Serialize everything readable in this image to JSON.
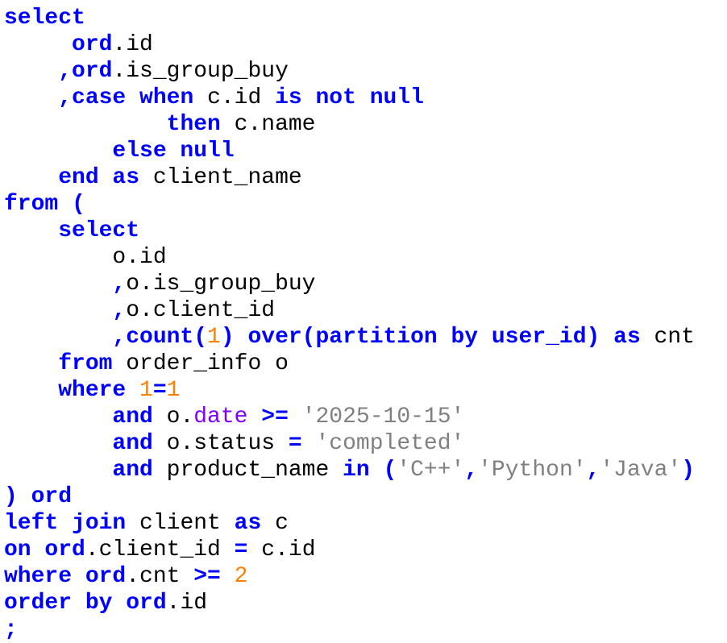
{
  "colors": {
    "keyword": "#0000ff",
    "number": "#ff8000",
    "string": "#808080",
    "function": "#8000ff",
    "text": "#000000",
    "background": "#ffffff"
  },
  "lines": [
    [
      {
        "t": "kw",
        "v": "select"
      }
    ],
    [
      {
        "t": "tx",
        "v": "     "
      },
      {
        "t": "kw",
        "v": "ord"
      },
      {
        "t": "tx",
        "v": ".id"
      }
    ],
    [
      {
        "t": "tx",
        "v": "    "
      },
      {
        "t": "kw",
        "v": ",ord"
      },
      {
        "t": "tx",
        "v": ".is_group_buy"
      }
    ],
    [
      {
        "t": "tx",
        "v": "    "
      },
      {
        "t": "kw",
        "v": ",case when "
      },
      {
        "t": "tx",
        "v": "c.id "
      },
      {
        "t": "kw",
        "v": "is not null"
      }
    ],
    [
      {
        "t": "tx",
        "v": "            "
      },
      {
        "t": "kw",
        "v": "then "
      },
      {
        "t": "tx",
        "v": "c.name"
      }
    ],
    [
      {
        "t": "tx",
        "v": "        "
      },
      {
        "t": "kw",
        "v": "else null"
      }
    ],
    [
      {
        "t": "tx",
        "v": "    "
      },
      {
        "t": "kw",
        "v": "end as "
      },
      {
        "t": "tx",
        "v": "client_name"
      }
    ],
    [
      {
        "t": "kw",
        "v": "from ("
      }
    ],
    [
      {
        "t": "tx",
        "v": "    "
      },
      {
        "t": "kw",
        "v": "select"
      }
    ],
    [
      {
        "t": "tx",
        "v": "        o.id"
      }
    ],
    [
      {
        "t": "tx",
        "v": "        "
      },
      {
        "t": "kw",
        "v": ","
      },
      {
        "t": "tx",
        "v": "o.is_group_buy"
      }
    ],
    [
      {
        "t": "tx",
        "v": "        "
      },
      {
        "t": "kw",
        "v": ","
      },
      {
        "t": "tx",
        "v": "o.client_id"
      }
    ],
    [
      {
        "t": "tx",
        "v": "        "
      },
      {
        "t": "kw",
        "v": ",count("
      },
      {
        "t": "num",
        "v": "1"
      },
      {
        "t": "kw",
        "v": ") over(partition by user_id) as "
      },
      {
        "t": "tx",
        "v": "cnt"
      }
    ],
    [
      {
        "t": "tx",
        "v": "    "
      },
      {
        "t": "kw",
        "v": "from "
      },
      {
        "t": "tx",
        "v": "order_info o"
      }
    ],
    [
      {
        "t": "tx",
        "v": "    "
      },
      {
        "t": "kw",
        "v": "where "
      },
      {
        "t": "num",
        "v": "1"
      },
      {
        "t": "kw",
        "v": "="
      },
      {
        "t": "num",
        "v": "1"
      }
    ],
    [
      {
        "t": "tx",
        "v": "        "
      },
      {
        "t": "kw",
        "v": "and "
      },
      {
        "t": "tx",
        "v": "o."
      },
      {
        "t": "fn",
        "v": "date"
      },
      {
        "t": "tx",
        "v": " "
      },
      {
        "t": "kw",
        "v": ">="
      },
      {
        "t": "tx",
        "v": " "
      },
      {
        "t": "str",
        "v": "'2025-10-15'"
      }
    ],
    [
      {
        "t": "tx",
        "v": "        "
      },
      {
        "t": "kw",
        "v": "and "
      },
      {
        "t": "tx",
        "v": "o.status "
      },
      {
        "t": "kw",
        "v": "="
      },
      {
        "t": "tx",
        "v": " "
      },
      {
        "t": "str",
        "v": "'completed'"
      }
    ],
    [
      {
        "t": "tx",
        "v": "        "
      },
      {
        "t": "kw",
        "v": "and "
      },
      {
        "t": "tx",
        "v": "product_name "
      },
      {
        "t": "kw",
        "v": "in ("
      },
      {
        "t": "str",
        "v": "'C++'"
      },
      {
        "t": "kw",
        "v": ","
      },
      {
        "t": "str",
        "v": "'Python'"
      },
      {
        "t": "kw",
        "v": ","
      },
      {
        "t": "str",
        "v": "'Java'"
      },
      {
        "t": "kw",
        "v": ")"
      }
    ],
    [
      {
        "t": "kw",
        "v": ") ord"
      }
    ],
    [
      {
        "t": "kw",
        "v": "left join "
      },
      {
        "t": "tx",
        "v": "client "
      },
      {
        "t": "kw",
        "v": "as "
      },
      {
        "t": "tx",
        "v": "c"
      }
    ],
    [
      {
        "t": "kw",
        "v": "on ord"
      },
      {
        "t": "tx",
        "v": ".client_id "
      },
      {
        "t": "kw",
        "v": "="
      },
      {
        "t": "tx",
        "v": " c.id"
      }
    ],
    [
      {
        "t": "kw",
        "v": "where ord"
      },
      {
        "t": "tx",
        "v": ".cnt "
      },
      {
        "t": "kw",
        "v": ">="
      },
      {
        "t": "tx",
        "v": " "
      },
      {
        "t": "num",
        "v": "2"
      }
    ],
    [
      {
        "t": "kw",
        "v": "order by ord"
      },
      {
        "t": "tx",
        "v": ".id"
      }
    ],
    [
      {
        "t": "kw",
        "v": ";"
      }
    ]
  ]
}
